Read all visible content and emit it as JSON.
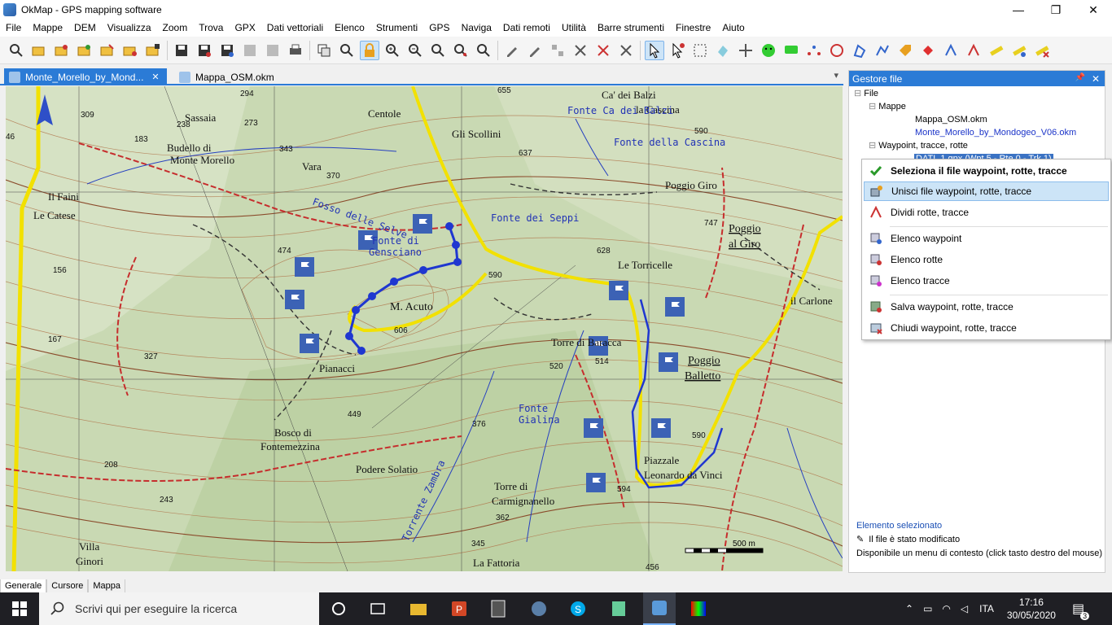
{
  "window": {
    "title": "OkMap - GPS mapping software",
    "minimize": "—",
    "maximize": "❐",
    "close": "✕"
  },
  "menu": [
    "File",
    "Mappe",
    "DEM",
    "Visualizza",
    "Zoom",
    "Trova",
    "GPX",
    "Dati vettoriali",
    "Elenco",
    "Strumenti",
    "GPS",
    "Naviga",
    "Dati remoti",
    "Utilità",
    "Barre strumenti",
    "Finestre",
    "Aiuto"
  ],
  "tabs": [
    {
      "label": "Monte_Morello_by_Mond...",
      "close": "✕"
    },
    {
      "label": "Mappa_OSM.okm"
    }
  ],
  "tab_dropdown": "▾",
  "map": {
    "labels": [
      "Sassaia",
      "Centole",
      "Gli Scollini",
      "Ca' dei Balzi",
      "la Cascina",
      "Fonte Ca dei Balzi",
      "Fonte della Cascina",
      "Budello di",
      "Monte Morello",
      "Vara",
      "Il Faini",
      "Le Catese",
      "Poggio Giro",
      "Poggio",
      "al Giro",
      "Fonte dei Seppi",
      "Fonte di",
      "Gensciano",
      "Fosso delle Selve",
      "Le Torricelle",
      "M. Acuto",
      "Torre di Baracca",
      "Poggio",
      "Balletto",
      "il Carlone",
      "Pianacci",
      "Bosco di",
      "Fontemezzina",
      "Fonte",
      "Gialina",
      "Podere Solatio",
      "Torre di",
      "Carmignanello",
      "Piazzale",
      "Leonardo da Vinci",
      "Villa",
      "Ginori",
      "Torrente Zambra",
      "La Fattoria"
    ],
    "elevations": [
      "309",
      "294",
      "273",
      "238",
      "183",
      "343",
      "370",
      "655",
      "637",
      "590",
      "747",
      "628",
      "474",
      "590",
      "606",
      "520",
      "514",
      "449",
      "327",
      "376",
      "590",
      "594",
      "362",
      "345",
      "208",
      "243",
      "167",
      "156",
      "46",
      "456"
    ],
    "scale": "500 m"
  },
  "panel": {
    "title": "Gestore file",
    "pin": "📌",
    "close": "✕",
    "tree": {
      "root": "File",
      "maps_group": "Mappe",
      "map1": "Mappa_OSM.okm",
      "map2": "Monte_Morello_by_Mondogeo_V06.okm",
      "wpt_group": "Waypoint, tracce, rotte",
      "wpt_file": "DATI_1.gpx (Wpt 5 - Rte 0 - Trk 1)"
    },
    "selected_title": "Elemento selezionato",
    "modified_text": "Il file è stato modificato",
    "context_hint": "Disponibile un menu di contesto (click tasto destro del mouse)"
  },
  "context_menu": [
    "Seleziona il file waypoint, rotte, tracce",
    "Unisci file waypoint, rotte, tracce",
    "Dividi rotte, tracce",
    "Elenco waypoint",
    "Elenco rotte",
    "Elenco tracce",
    "Salva waypoint, rotte, tracce",
    "Chiudi waypoint, rotte, tracce"
  ],
  "bottom_tabs": [
    "Generale",
    "Cursore",
    "Mappa"
  ],
  "taskbar": {
    "search_placeholder": "Scrivi qui per eseguire la ricerca",
    "lang": "ITA",
    "time": "17:16",
    "date": "30/05/2020",
    "notifications": "3"
  },
  "colors": {
    "accent": "#2b7bd6",
    "track": "#1f37d0",
    "road": "#f5e000"
  }
}
